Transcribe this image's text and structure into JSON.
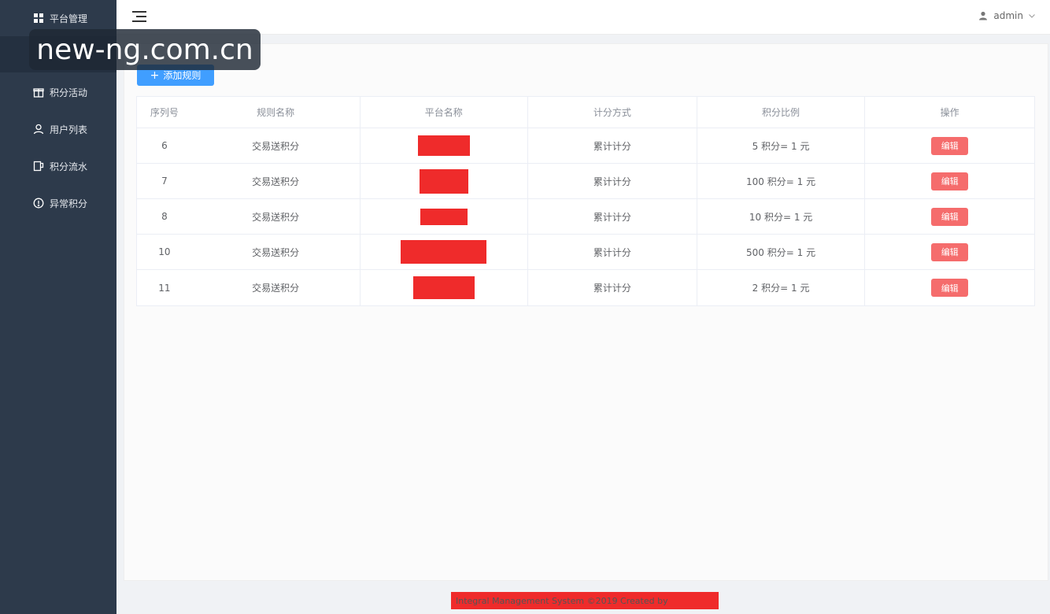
{
  "sidebar": {
    "items": [
      {
        "label": "平台管理",
        "icon": "grid-icon"
      },
      {
        "label": "",
        "icon": ""
      },
      {
        "label": "积分活动",
        "icon": "gift-icon"
      },
      {
        "label": "用户列表",
        "icon": "user-icon"
      },
      {
        "label": "积分流水",
        "icon": "ledger-icon"
      },
      {
        "label": "异常积分",
        "icon": "alert-circle-icon"
      }
    ]
  },
  "header": {
    "username": "admin"
  },
  "watermark": "new-ng.com.cn",
  "toolbar": {
    "add_label": "添加规则"
  },
  "table": {
    "columns": [
      "序列号",
      "规则名称",
      "平台名称",
      "计分方式",
      "积分比例",
      "操作"
    ],
    "rows": [
      {
        "id": "6",
        "rule": "交易送积分",
        "platform": "",
        "method": "累计计分",
        "ratio": "5 积分= 1 元",
        "action": "编辑"
      },
      {
        "id": "7",
        "rule": "交易送积分",
        "platform": "",
        "method": "累计计分",
        "ratio": "100 积分= 1 元",
        "action": "编辑"
      },
      {
        "id": "8",
        "rule": "交易送积分",
        "platform": "",
        "method": "累计计分",
        "ratio": "10 积分= 1 元",
        "action": "编辑"
      },
      {
        "id": "10",
        "rule": "交易送积分",
        "platform": "",
        "method": "累计计分",
        "ratio": "500 积分= 1 元",
        "action": "编辑"
      },
      {
        "id": "11",
        "rule": "交易送积分",
        "platform": "",
        "method": "累计计分",
        "ratio": "2 积分= 1 元",
        "action": "编辑"
      }
    ]
  },
  "footer": {
    "text": "Integral Management System ©2019 Created by"
  },
  "colors": {
    "sidebar": "#2d3a4b",
    "primary": "#409eff",
    "danger": "#f56c6c",
    "redaction": "#ef2b2b"
  }
}
